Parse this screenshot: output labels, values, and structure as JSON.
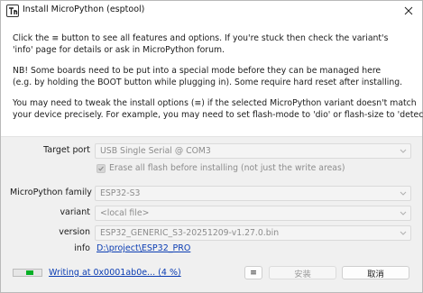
{
  "window": {
    "title": "Install MicroPython (esptool)",
    "close_icon": "close-icon",
    "app_icon": "thonny-icon"
  },
  "info": {
    "paragraph1_line1": "Click the ≡ button to see all features and options. If you're stuck then check the variant's",
    "paragraph1_line2": "'info' page for details or ask in MicroPython forum.",
    "paragraph2_line1": "NB! Some boards need to be put into a special mode before they can be managed here",
    "paragraph2_line2": "(e.g. by holding the BOOT button while plugging in). Some require hard reset after installing.",
    "paragraph3_line1": "You may need to tweak the install options (≡) if the selected MicroPython variant doesn't match",
    "paragraph3_line2": "your device precisely. For example, you may need to set flash-mode to 'dio' or flash-size to 'detect'."
  },
  "form": {
    "target_port_label": "Target port",
    "target_port_value": "USB Single Serial @ COM3",
    "erase_label": "Erase all flash before installing (not just the write areas)",
    "erase_checked": true,
    "family_label": "MicroPython family",
    "family_value": "ESP32-S3",
    "variant_label": "variant",
    "variant_value": "<local file>",
    "version_label": "version",
    "version_value": "ESP32_GENERIC_S3-20251209-v1.27.0.bin",
    "info_label": "info",
    "info_link": "D:\\project\\ESP32_PRO"
  },
  "footer": {
    "progress_fraction": 0.04,
    "status_text": "Writing at 0x0001ab0e... (4 %)",
    "menu_button": "≡",
    "install_button": "安装",
    "cancel_button": "取消"
  },
  "colors": {
    "progress": "#06b025",
    "link": "#0b3db3"
  }
}
